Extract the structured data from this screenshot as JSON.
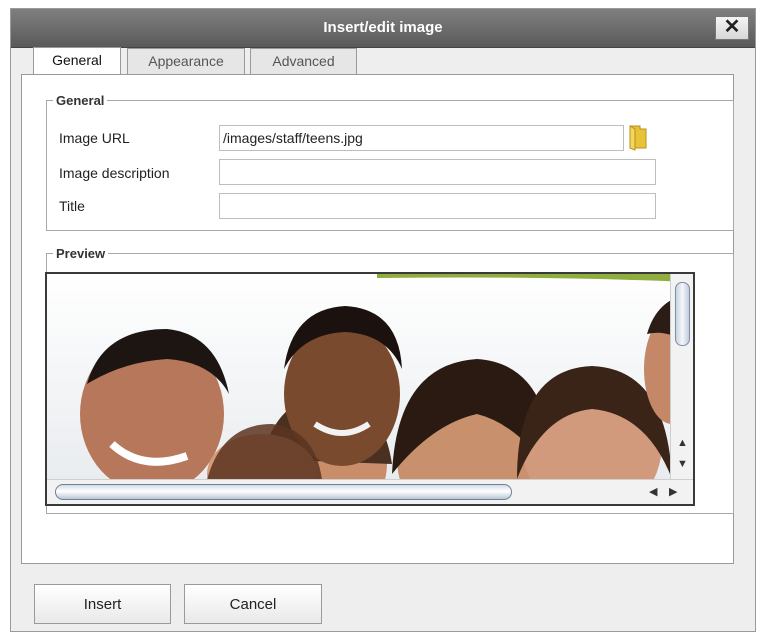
{
  "dialog": {
    "title": "Insert/edit image",
    "close_label": "✕"
  },
  "tabs": [
    {
      "label": "General",
      "active": true
    },
    {
      "label": "Appearance",
      "active": false
    },
    {
      "label": "Advanced",
      "active": false
    }
  ],
  "general": {
    "legend": "General",
    "image_url": {
      "label": "Image URL",
      "value": "/images/staff/teens.jpg"
    },
    "image_description": {
      "label": "Image description",
      "value": ""
    },
    "title": {
      "label": "Title",
      "value": ""
    },
    "browse_icon": "folder-icon"
  },
  "preview": {
    "legend": "Preview",
    "image_subject": "group of smiling teens",
    "scroll_arrows": {
      "up": "▲",
      "down": "▼",
      "left": "◀",
      "right": "▶"
    }
  },
  "buttons": {
    "insert": "Insert",
    "cancel": "Cancel"
  },
  "colors": {
    "titlebar": "#6b6b6b",
    "dialog_bg": "#eeeeee",
    "folder": "#e8c33a"
  }
}
